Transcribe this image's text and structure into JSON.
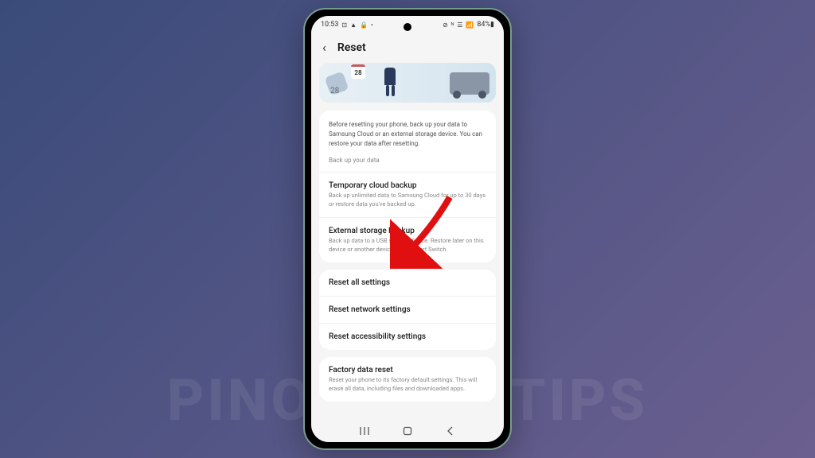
{
  "status_bar": {
    "time": "10:53",
    "left_icons": "⊡ ▲ 🔒 •",
    "right_icons": "⊘ ᴺ ☰ 📶",
    "battery": "84%▮"
  },
  "header": {
    "title": "Reset"
  },
  "banner": {
    "calendar_day": "28",
    "side_num": "28"
  },
  "intro": {
    "text": "Before resetting your phone, back up your data to Samsung Cloud or an external storage device. You can restore your data after resetting.",
    "label": "Back up your data"
  },
  "backup_items": [
    {
      "title": "Temporary cloud backup",
      "sub": "Back up unlimited data to Samsung Cloud for up to 30 days or restore data you've backed up."
    },
    {
      "title": "External storage backup",
      "sub": "Back up data to a USB storage device. Restore later on this device or another device using Smart Switch."
    }
  ],
  "reset_items": [
    {
      "title": "Reset all settings"
    },
    {
      "title": "Reset network settings"
    },
    {
      "title": "Reset accessibility settings"
    }
  ],
  "factory": {
    "title": "Factory data reset",
    "sub": "Reset your phone to its factory default settings. This will erase all data, including files and downloaded apps."
  },
  "watermark": "PINOYTECHTIPS"
}
